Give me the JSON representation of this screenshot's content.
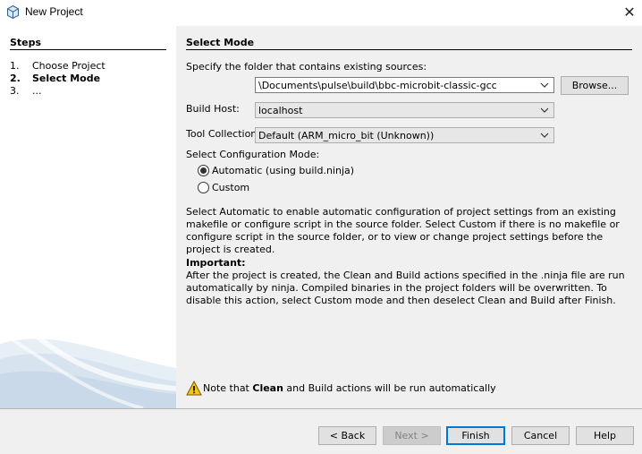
{
  "window": {
    "title": "New Project",
    "close_glyph": "✕"
  },
  "steps": {
    "heading": "Steps",
    "items": [
      {
        "num": "1.",
        "label": "Choose Project"
      },
      {
        "num": "2.",
        "label": "Select Mode",
        "active": true
      },
      {
        "num": "3.",
        "label": "..."
      }
    ]
  },
  "main": {
    "heading": "Select Mode",
    "folder_label": "Specify the folder that contains existing sources:",
    "folder_value": "\\Documents\\pulse\\build\\bbc-microbit-classic-gcc",
    "browse_label": "Browse...",
    "build_host_label": "Build Host:",
    "build_host_value": "localhost",
    "tool_collection_label": "Tool Collection:",
    "tool_collection_value": "Default (ARM_micro_bit (Unknown))",
    "config_mode_label": "Select Configuration Mode:",
    "radio_automatic": "Automatic (using build.ninja)",
    "radio_custom": "Custom",
    "selected_mode": "automatic",
    "description": "Select Automatic to enable automatic configuration of project settings from an existing makefile or configure script in the source folder. Select Custom if there is no makefile or configure script in the source folder, or to view or change project settings before the project is created.",
    "important_heading": "Important:",
    "important_text": "After the project is created, the Clean and Build actions specified in the .ninja file are run automatically by ninja. Compiled binaries in the project folders will be overwritten. To disable this action, select Custom mode and then deselect Clean and Build after Finish.",
    "warning_prefix": "Note that ",
    "warning_bold": "Clean",
    "warning_suffix": " and Build actions will be run automatically"
  },
  "buttons": {
    "back": "< Back",
    "next": "Next >",
    "finish": "Finish",
    "cancel": "Cancel",
    "help": "Help"
  },
  "icons": {
    "title": "netbeans-cube-icon",
    "warning": "warning-triangle-icon",
    "dropdown": "chevron-down-icon"
  },
  "colors": {
    "accent": "#0078d7",
    "panel_bg": "#f0f0f0",
    "warning_fill": "#f5c518"
  }
}
